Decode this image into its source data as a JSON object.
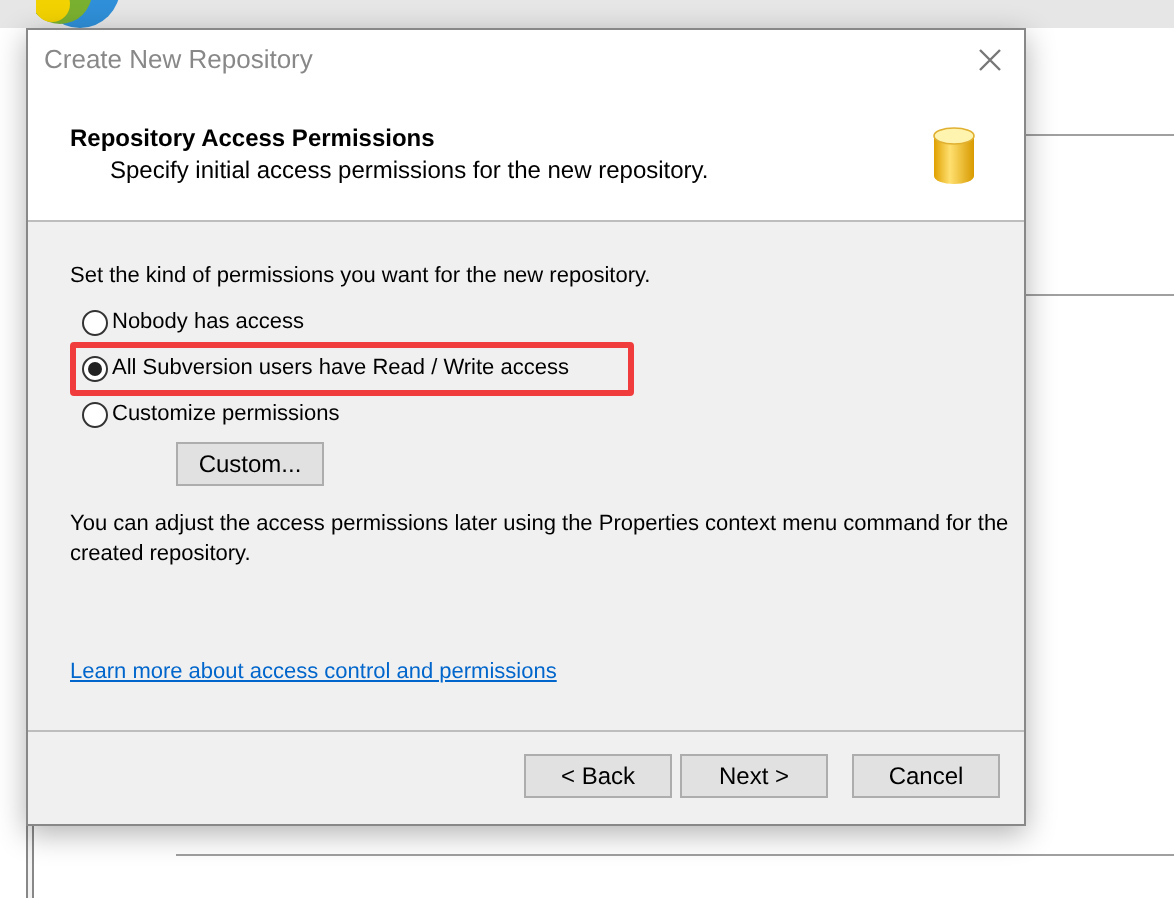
{
  "dialog": {
    "title": "Create New Repository",
    "header": {
      "title": "Repository Access Permissions",
      "subtitle": "Specify initial access permissions for the new repository."
    },
    "prompt": "Set the kind of permissions you want for the new repository.",
    "options": [
      {
        "label": "Nobody has access",
        "selected": false,
        "highlighted": false
      },
      {
        "label": "All Subversion users have Read / Write access",
        "selected": true,
        "highlighted": true
      },
      {
        "label": "Customize permissions",
        "selected": false,
        "highlighted": false
      }
    ],
    "custom_button": "Custom...",
    "note": "You can adjust the access permissions later using the Properties context menu command for the created repository.",
    "help_link": "Learn more about access control and permissions",
    "buttons": [
      "< Back",
      "Next >",
      "Cancel"
    ]
  }
}
